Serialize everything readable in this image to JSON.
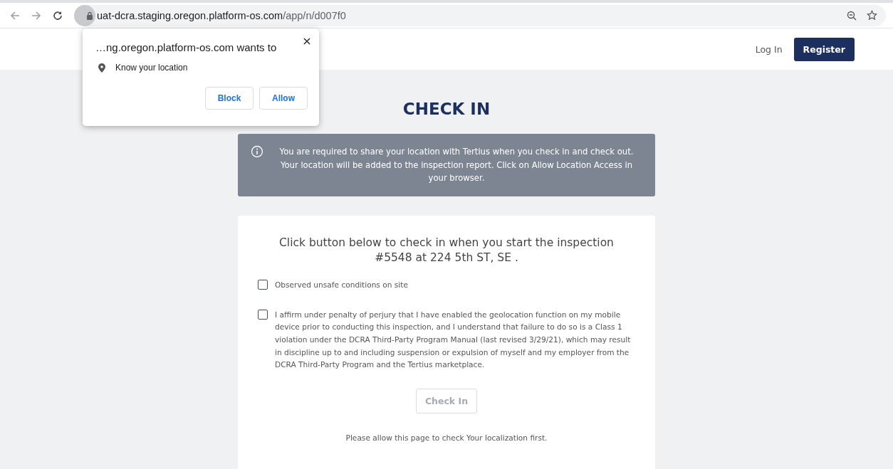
{
  "browser": {
    "url_host": "uat-dcra.staging.oregon.platform-os.com",
    "url_path": "/app/n/d007f0"
  },
  "permission_popup": {
    "title": "…ng.oregon.platform-os.com wants to",
    "request": "Know your location",
    "buttons": [
      "Block",
      "Allow"
    ]
  },
  "header": {
    "login": "Log In",
    "register": "Register"
  },
  "page_title": "CHECK IN",
  "alert": "You are required to share your location with Tertius when you check in and check out. Your location will be added to the inspection report. Click on Allow Location Access in your browser.",
  "card": {
    "intro": "Click button below to check in when you start the inspection #5548 at 224 5th ST, SE .",
    "checkboxes": [
      {
        "label": "Observed unsafe conditions on site",
        "checked": false
      },
      {
        "label": "I affirm under penalty of perjury that I have enabled the geolocation function on my mobile device prior to conducting this inspection, and I understand that failure to do so is a Class 1 violation under the DCRA Third-Party Program Manual (last revised 3/29/21), which may result in discipline up to and including suspension or expulsion of myself and my employer from the DCRA Third-Party Program and the Tertius marketplace.",
        "checked": false
      }
    ],
    "button": {
      "label": "Check In",
      "disabled": true
    },
    "note": "Please allow this page to check Your localization first."
  }
}
